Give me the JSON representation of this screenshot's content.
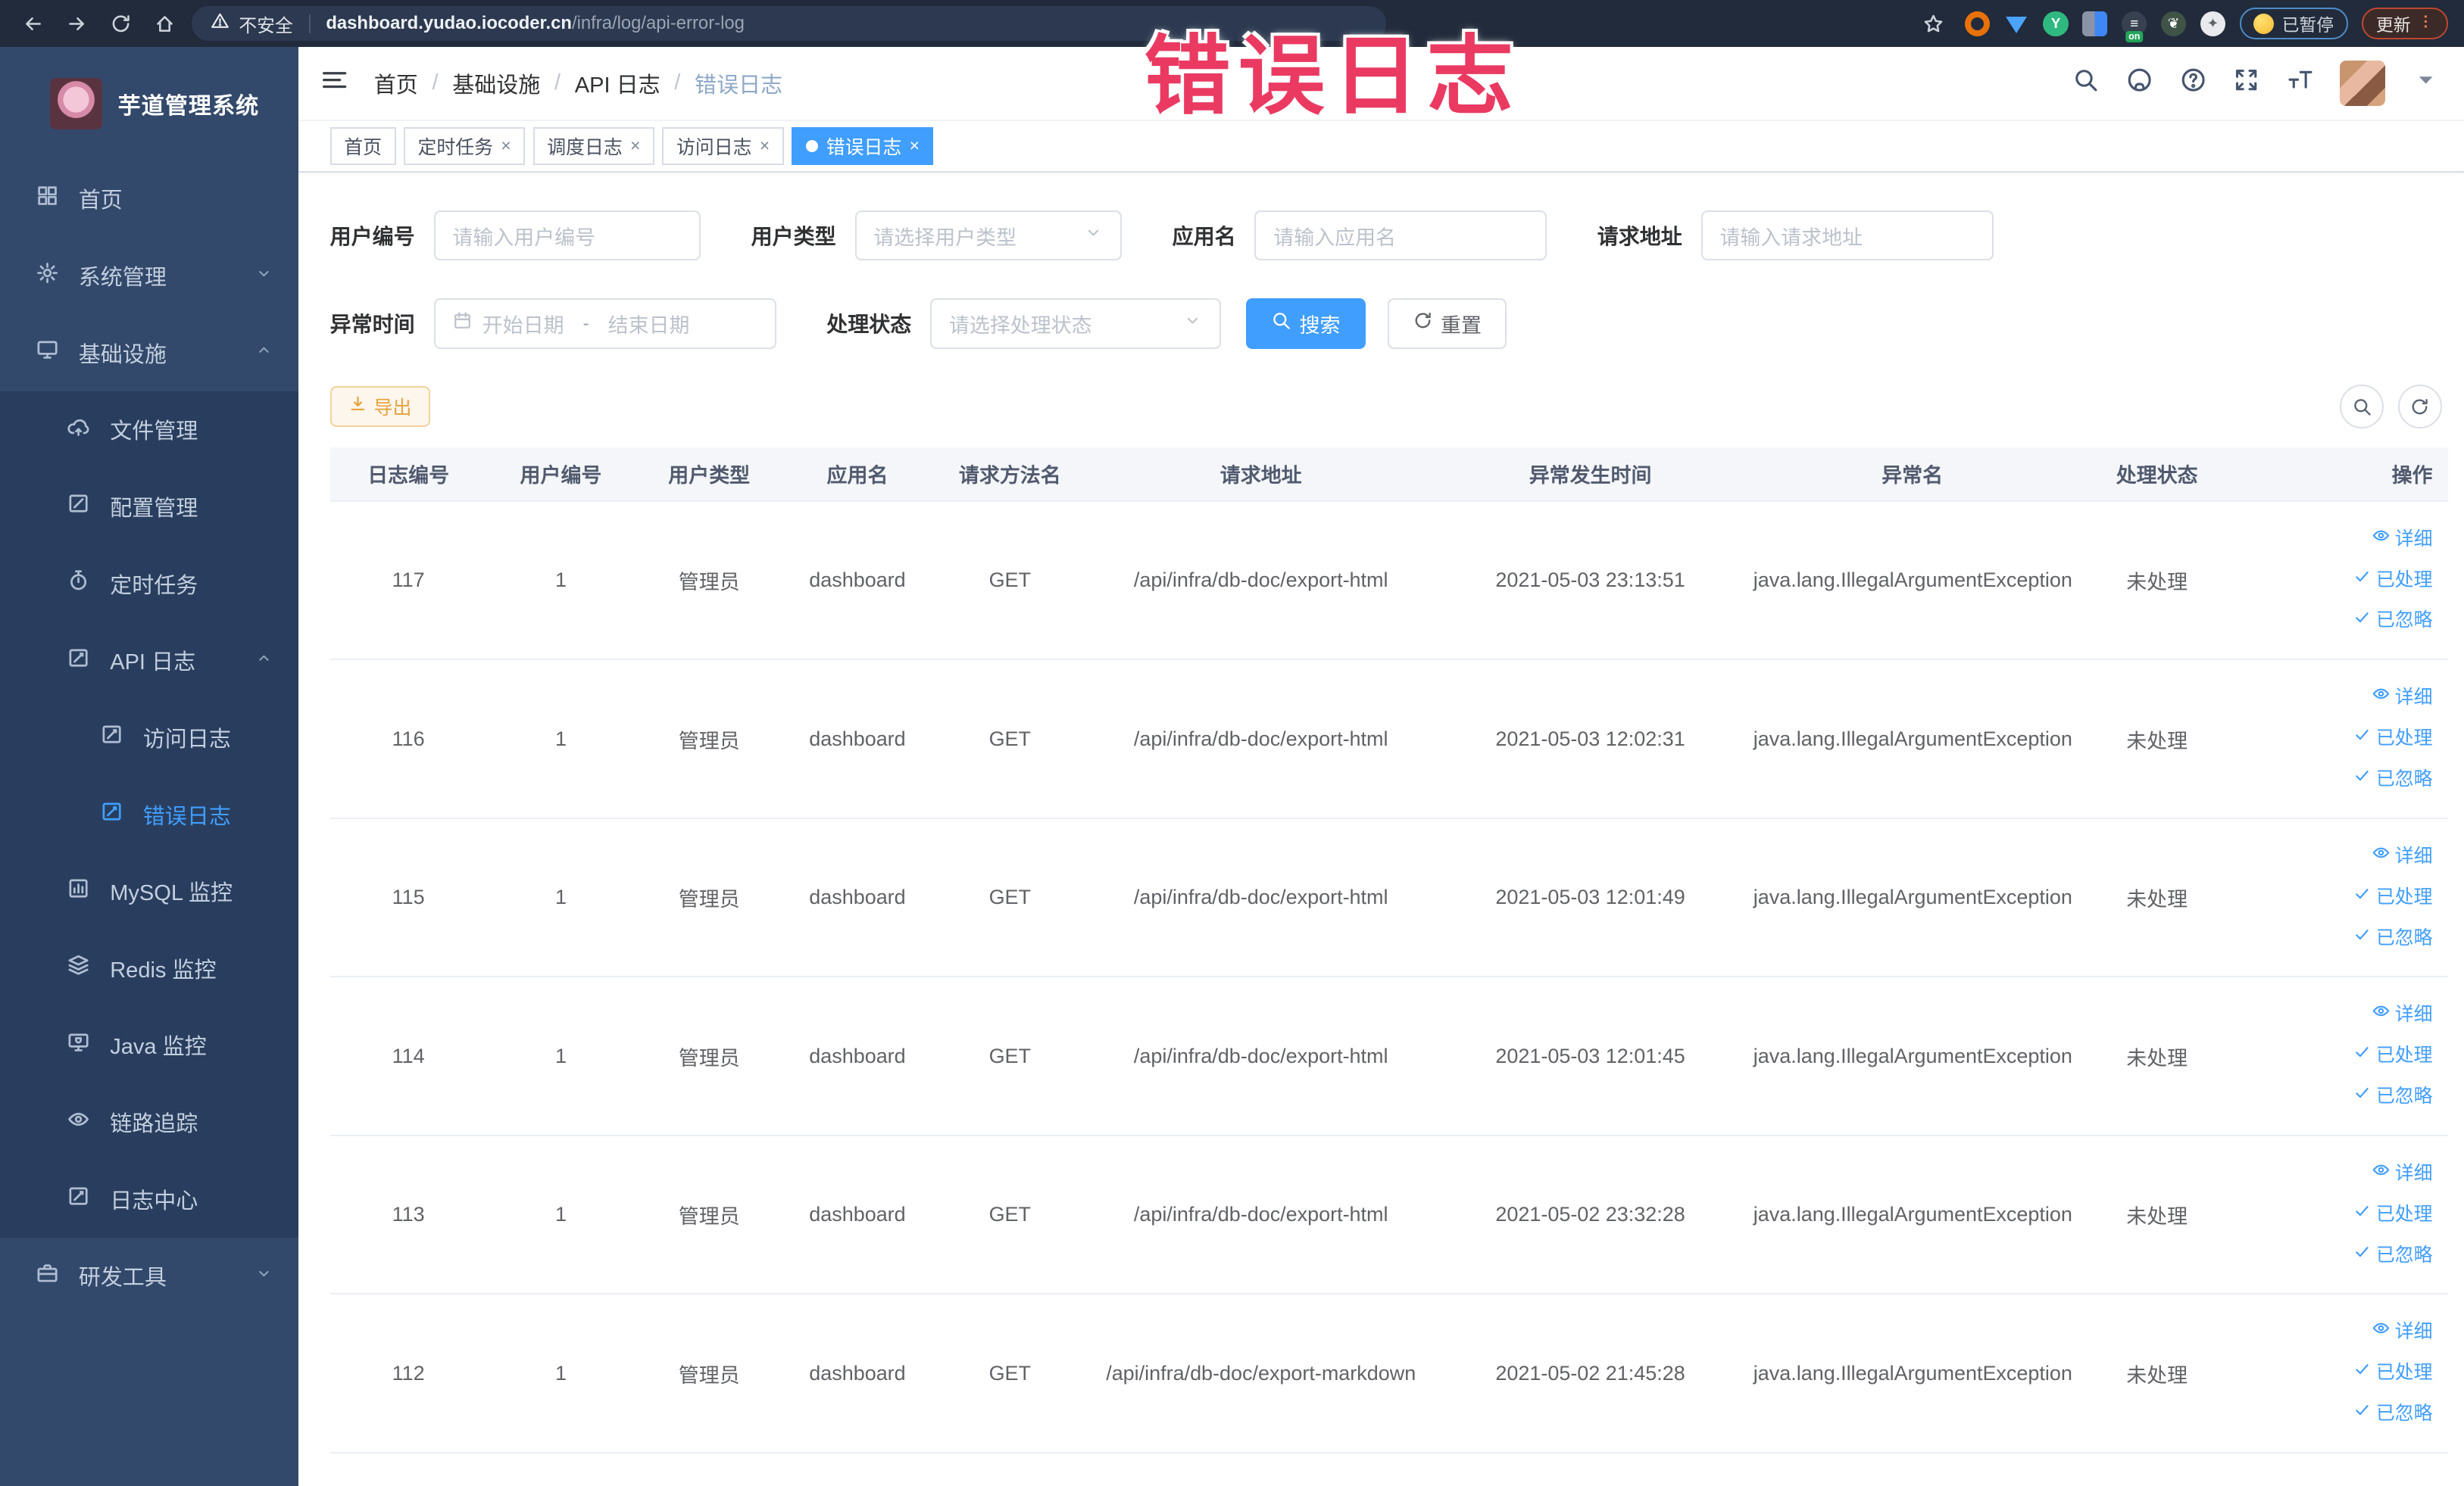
{
  "browser": {
    "security_label": "不安全",
    "url_domain": "dashboard.yudao.iocoder.cn",
    "url_path": "/infra/log/api-error-log",
    "paused_badge": "已暂停",
    "update_button": "更新",
    "extensions": [
      {
        "name": "extension-adblock-icon",
        "style": "ring",
        "color": "#e8710a",
        "glyph": ""
      },
      {
        "name": "extension-drop-icon",
        "style": "drop",
        "color": "#4aa3ff",
        "glyph": ""
      },
      {
        "name": "extension-vue-icon",
        "style": "solid",
        "color": "#2fb980",
        "glyph": "Y"
      },
      {
        "name": "extension-grid-icon",
        "style": "grid",
        "color": "#8a94a6",
        "glyph": ""
      },
      {
        "name": "extension-switch-icon",
        "style": "solid badge-on",
        "color": "#37414f",
        "glyph": "≡"
      },
      {
        "name": "extension-leaf-icon",
        "style": "solid",
        "color": "#3f5347",
        "glyph": "❦"
      },
      {
        "name": "extension-puzzle-icon",
        "style": "solid",
        "color": "#e8eaed",
        "glyph": "✦"
      }
    ]
  },
  "overlay": {
    "text": "错误日志"
  },
  "sidebar": {
    "logo_title": "芋道管理系统",
    "items": [
      {
        "id": "home",
        "label": "首页",
        "icon": "home-icon"
      },
      {
        "id": "system",
        "label": "系统管理",
        "icon": "gear-icon",
        "children": [],
        "expanded": false
      },
      {
        "id": "infra",
        "label": "基础设施",
        "icon": "infrastructure-icon",
        "expanded": true,
        "children": [
          {
            "id": "file",
            "label": "文件管理",
            "icon": "file-upload-icon"
          },
          {
            "id": "config",
            "label": "配置管理",
            "icon": "edit-icon"
          },
          {
            "id": "job",
            "label": "定时任务",
            "icon": "timer-icon"
          },
          {
            "id": "api-log",
            "label": "API 日志",
            "icon": "log-icon",
            "expanded": true,
            "children": [
              {
                "id": "access-log",
                "label": "访问日志",
                "icon": "log-icon"
              },
              {
                "id": "error-log",
                "label": "错误日志",
                "icon": "log-icon",
                "active": true
              }
            ]
          },
          {
            "id": "mysql",
            "label": "MySQL 监控",
            "icon": "chart-icon"
          },
          {
            "id": "redis",
            "label": "Redis 监控",
            "icon": "layers-icon"
          },
          {
            "id": "java",
            "label": "Java 监控",
            "icon": "java-icon"
          },
          {
            "id": "trace",
            "label": "链路追踪",
            "icon": "eye-icon"
          },
          {
            "id": "log-center",
            "label": "日志中心",
            "icon": "log-icon"
          }
        ]
      },
      {
        "id": "dev-tools",
        "label": "研发工具",
        "icon": "toolbox-icon",
        "children": [],
        "expanded": false
      }
    ]
  },
  "header": {
    "breadcrumb": [
      "首页",
      "基础设施",
      "API 日志",
      "错误日志"
    ],
    "icons": [
      {
        "name": "search-icon"
      },
      {
        "name": "github-icon"
      },
      {
        "name": "help-icon"
      },
      {
        "name": "fullscreen-icon"
      },
      {
        "name": "font-size-icon"
      }
    ]
  },
  "tabs": [
    {
      "label": "首页",
      "closable": false,
      "active": false
    },
    {
      "label": "定时任务",
      "closable": true,
      "active": false
    },
    {
      "label": "调度日志",
      "closable": true,
      "active": false
    },
    {
      "label": "访问日志",
      "closable": true,
      "active": false
    },
    {
      "label": "错误日志",
      "closable": true,
      "active": true
    }
  ],
  "filters": {
    "user_id": {
      "label": "用户编号",
      "placeholder": "请输入用户编号"
    },
    "user_type": {
      "label": "用户类型",
      "placeholder": "请选择用户类型"
    },
    "app_name": {
      "label": "应用名",
      "placeholder": "请输入应用名"
    },
    "request_url": {
      "label": "请求地址",
      "placeholder": "请输入请求地址"
    },
    "exception_time": {
      "label": "异常时间",
      "start_placeholder": "开始日期",
      "separator": "-",
      "end_placeholder": "结束日期"
    },
    "process_status": {
      "label": "处理状态",
      "placeholder": "请选择处理状态"
    },
    "search_button": "搜索",
    "reset_button": "重置"
  },
  "toolbar": {
    "export_button": "导出"
  },
  "table": {
    "headers": [
      "日志编号",
      "用户编号",
      "用户类型",
      "应用名",
      "请求方法名",
      "请求地址",
      "异常发生时间",
      "异常名",
      "处理状态",
      "操作"
    ],
    "action_labels": [
      "详细",
      "已处理",
      "已忽略"
    ],
    "rows": [
      {
        "id": "117",
        "user_id": "1",
        "user_type": "管理员",
        "app": "dashboard",
        "method": "GET",
        "url": "/api/infra/db-doc/export-html",
        "time": "2021-05-03 23:13:51",
        "exception": "java.lang.IllegalArgumentException",
        "status": "未处理"
      },
      {
        "id": "116",
        "user_id": "1",
        "user_type": "管理员",
        "app": "dashboard",
        "method": "GET",
        "url": "/api/infra/db-doc/export-html",
        "time": "2021-05-03 12:02:31",
        "exception": "java.lang.IllegalArgumentException",
        "status": "未处理"
      },
      {
        "id": "115",
        "user_id": "1",
        "user_type": "管理员",
        "app": "dashboard",
        "method": "GET",
        "url": "/api/infra/db-doc/export-html",
        "time": "2021-05-03 12:01:49",
        "exception": "java.lang.IllegalArgumentException",
        "status": "未处理"
      },
      {
        "id": "114",
        "user_id": "1",
        "user_type": "管理员",
        "app": "dashboard",
        "method": "GET",
        "url": "/api/infra/db-doc/export-html",
        "time": "2021-05-03 12:01:45",
        "exception": "java.lang.IllegalArgumentException",
        "status": "未处理"
      },
      {
        "id": "113",
        "user_id": "1",
        "user_type": "管理员",
        "app": "dashboard",
        "method": "GET",
        "url": "/api/infra/db-doc/export-html",
        "time": "2021-05-02 23:32:28",
        "exception": "java.lang.IllegalArgumentException",
        "status": "未处理"
      },
      {
        "id": "112",
        "user_id": "1",
        "user_type": "管理员",
        "app": "dashboard",
        "method": "GET",
        "url": "/api/infra/db-doc/export-markdown",
        "time": "2021-05-02 21:45:28",
        "exception": "java.lang.IllegalArgumentException",
        "status": "未处理"
      }
    ]
  },
  "colors": {
    "accent": "#409eff",
    "warning": "#e6a23c",
    "sidebar_bg": "#33496b",
    "submenu_bg": "#293e5e",
    "overlay_pink": "#ea3a62",
    "browser_bar": "#212b3b"
  }
}
